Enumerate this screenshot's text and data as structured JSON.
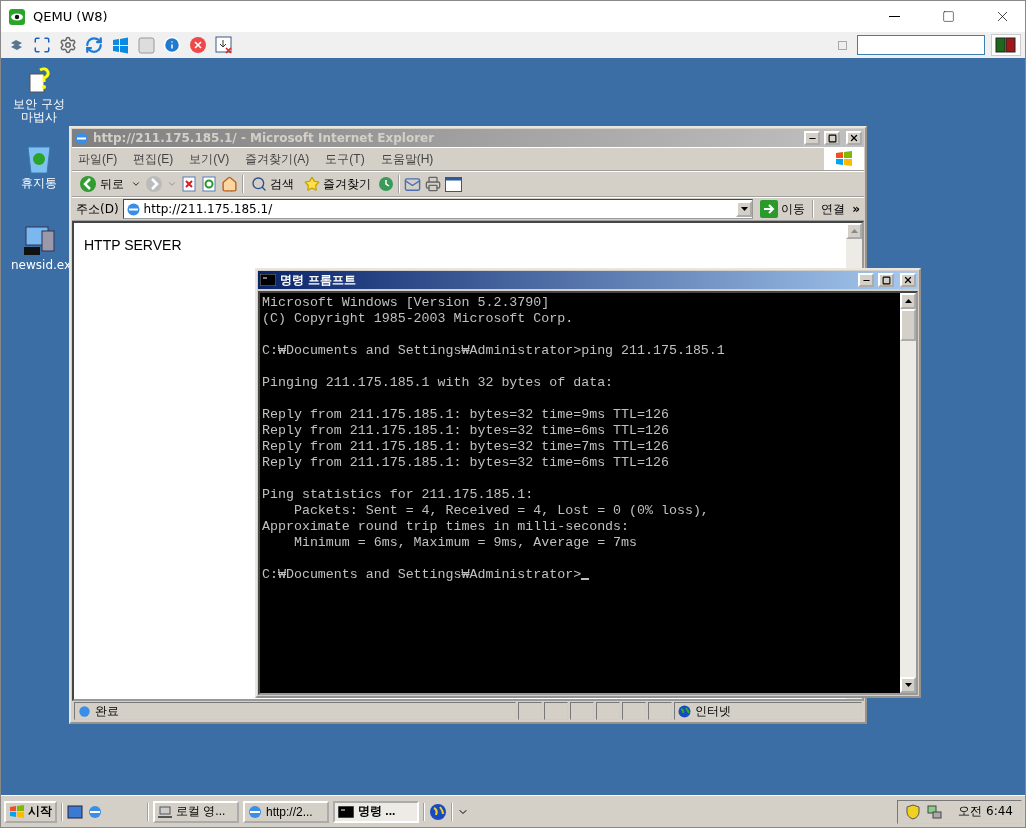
{
  "host_window": {
    "title": "QEMU (W8)"
  },
  "desktop_icons": [
    {
      "label": "보안 구성 마법사",
      "kind": "wizard"
    },
    {
      "label": "휴지통",
      "kind": "recycle"
    },
    {
      "label": "newsid.ex",
      "kind": "computer"
    }
  ],
  "browser_window": {
    "title": "http://211.175.185.1/ - Microsoft Internet Explorer",
    "active": false,
    "menu": [
      "파일(F)",
      "편집(E)",
      "보기(V)",
      "즐겨찾기(A)",
      "도구(T)",
      "도움말(H)"
    ],
    "toolbar": [
      {
        "label": "뒤로",
        "kind": "back"
      },
      {
        "label": "검색",
        "kind": "search"
      },
      {
        "label": "즐겨찾기",
        "kind": "favorites"
      }
    ],
    "address_label": "주소(D)",
    "address": "http://211.175.185.1/",
    "go": "이동",
    "links": "연결",
    "links_more": "»",
    "page_text": "HTTP SERVER",
    "status": "완료",
    "zone": "인터넷"
  },
  "console_window": {
    "title": "명령 프롬프트",
    "active": true,
    "cursor": true,
    "blocks": [
      [
        "Microsoft Windows [Version 5.2.3790]",
        "(C) Copyright 1985-2003 Microsoft Corp."
      ],
      [
        "C:₩Documents and Settings₩Administrator>ping 211.175.185.1"
      ],
      [
        "Pinging 211.175.185.1 with 32 bytes of data:"
      ],
      [
        "Reply from 211.175.185.1: bytes=32 time=9ms TTL=126",
        "Reply from 211.175.185.1: bytes=32 time=6ms TTL=126",
        "Reply from 211.175.185.1: bytes=32 time=7ms TTL=126",
        "Reply from 211.175.185.1: bytes=32 time=6ms TTL=126"
      ],
      [
        "Ping statistics for 211.175.185.1:",
        "    Packets: Sent = 4, Received = 4, Lost = 0 (0% loss),",
        "Approximate round trip times in milli-seconds:",
        "    Minimum = 6ms, Maximum = 9ms, Average = 7ms"
      ],
      [
        "C:₩Documents and Settings₩Administrator>"
      ]
    ]
  },
  "taskbar": {
    "start": "시작",
    "tasks": [
      {
        "label": "로컬 영...",
        "kind": "network",
        "selected": false
      },
      {
        "label": "http://2...",
        "kind": "browser",
        "selected": false
      },
      {
        "label": "명령 ...",
        "kind": "console",
        "selected": true
      }
    ],
    "clock": "오전 6:44"
  }
}
